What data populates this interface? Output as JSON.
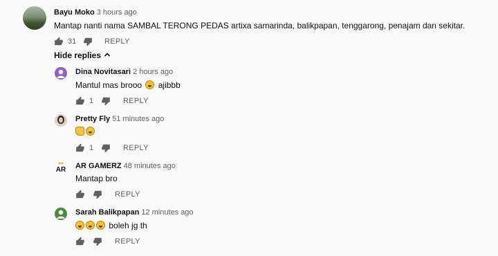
{
  "top_comment": {
    "author": "Bayu Moko",
    "time": "3 hours ago",
    "text": "Mantap nanti nama SAMBAL TERONG PEDAS artixa samarinda, balikpapan, tenggarong, penajam dan sekitar.",
    "likes": "31",
    "reply_label": "REPLY"
  },
  "hide_replies_label": "Hide replies",
  "replies": [
    {
      "author": "Dina Novitasari",
      "time": "2 hours ago",
      "text": "ajibbb",
      "likes": "1",
      "reply_label": "REPLY",
      "text_before": "Mantul mas brooo"
    },
    {
      "author": "Pretty Fly",
      "time": "51 minutes ago",
      "likes": "1",
      "reply_label": "REPLY"
    },
    {
      "author": "AR GAMERZ",
      "time": "48 minutes ago",
      "text": "Mantap bro",
      "likes": "",
      "reply_label": "REPLY",
      "avatar_text": "AR"
    },
    {
      "author": "Sarah Balikpapan",
      "time": "12 minutes ago",
      "text": "boleh jg th",
      "likes": "",
      "reply_label": "REPLY"
    }
  ],
  "colors": {
    "background": "#f9f9f9",
    "avatar_dina": "#8f61c9",
    "avatar_sarah": "#4b8a3b"
  }
}
